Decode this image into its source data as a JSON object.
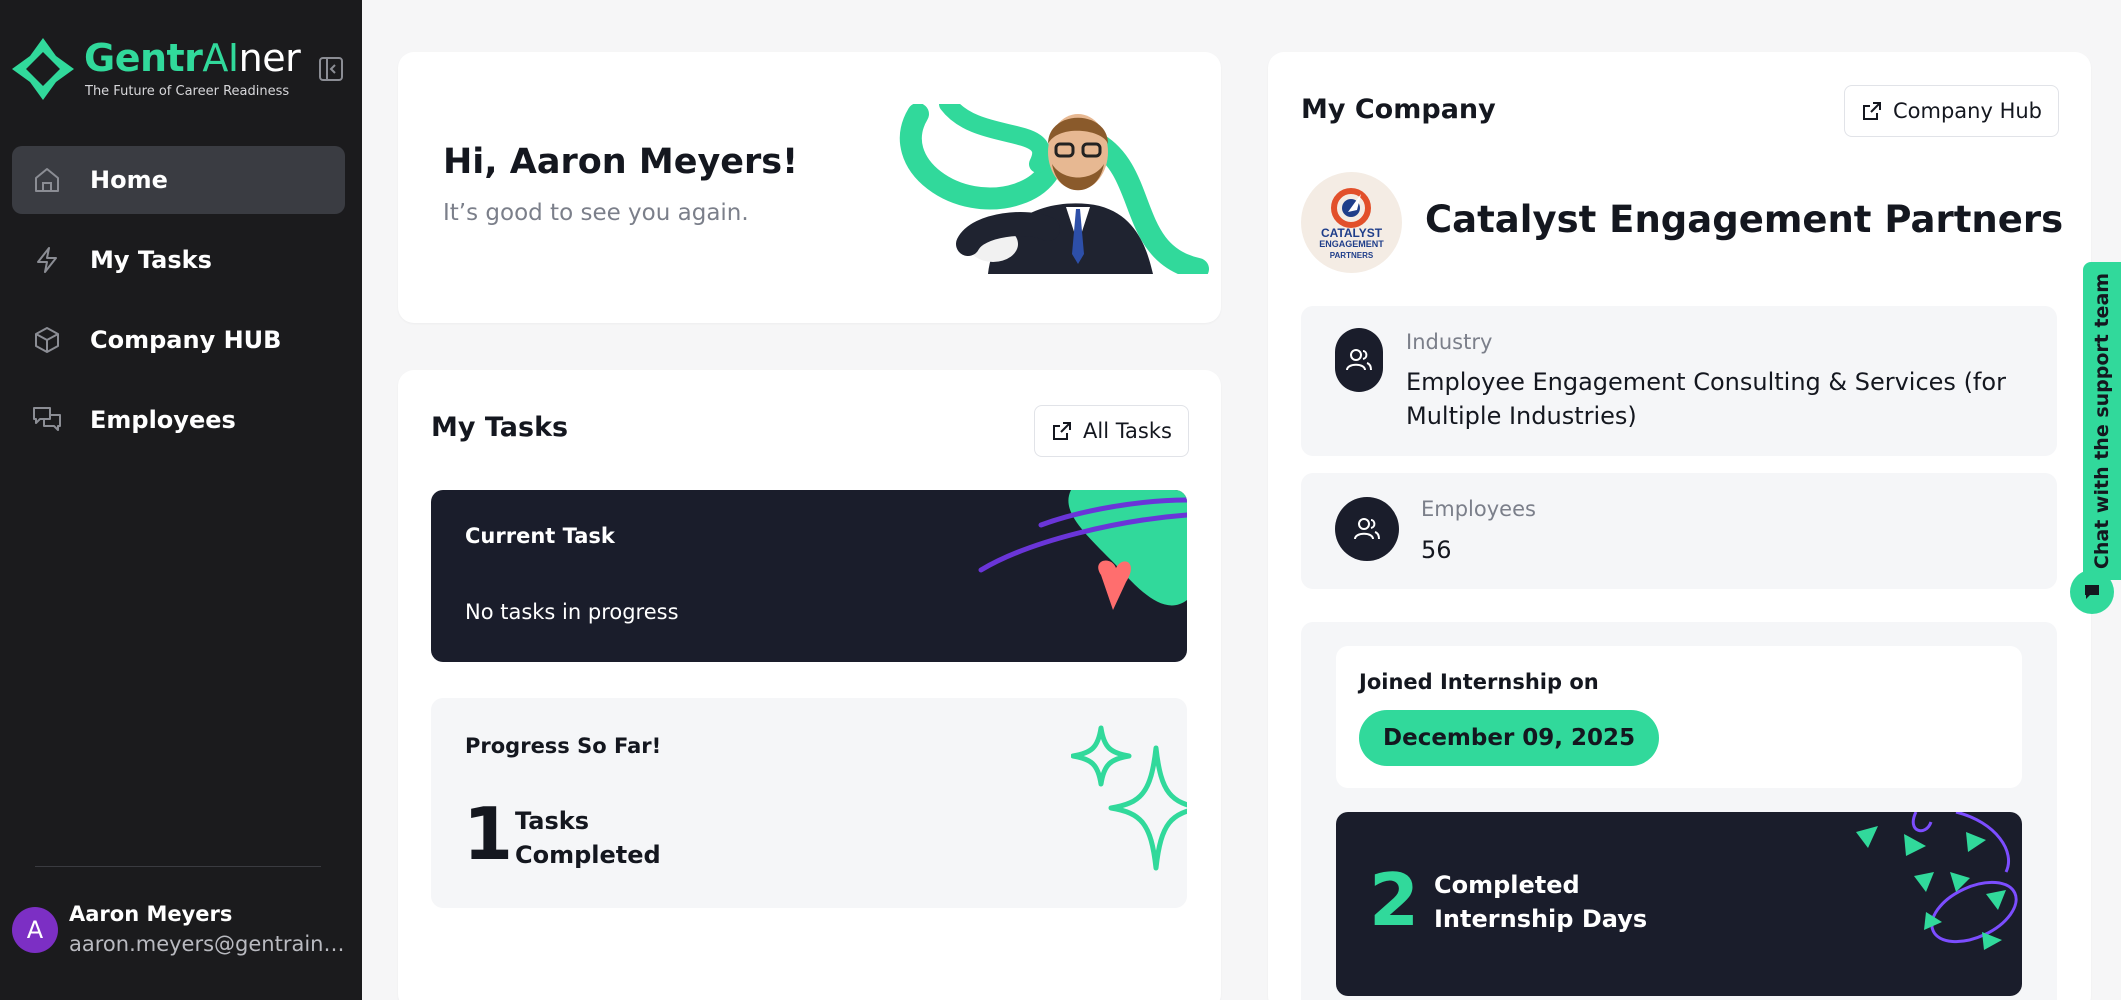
{
  "brand": {
    "name_part1": "Gentr",
    "name_part2": "AI",
    "name_part3": "ner",
    "tagline": "The Future of Career Readiness",
    "accent_color": "#31d99b"
  },
  "sidebar": {
    "items": [
      {
        "label": "Home",
        "icon": "home-icon",
        "active": true
      },
      {
        "label": "My Tasks",
        "icon": "lightning-icon",
        "active": false
      },
      {
        "label": "Company HUB",
        "icon": "cube-icon",
        "active": false
      },
      {
        "label": "Employees",
        "icon": "chat-bubbles-icon",
        "active": false
      }
    ],
    "collapse_icon": "sidebar-collapse-icon"
  },
  "user": {
    "initial": "A",
    "name": "Aaron Meyers",
    "email": "aaron.meyers@gentrainer.com",
    "avatar_color": "#7c2fc4"
  },
  "greeting": {
    "title": "Hi, Aaron Meyers!",
    "subtitle": "It’s good to see you again."
  },
  "tasks": {
    "title": "My Tasks",
    "all_tasks_label": "All Tasks",
    "current_title": "Current Task",
    "current_status": "No tasks in progress",
    "progress_title": "Progress So Far!",
    "completed_count": "1",
    "completed_label": "Tasks Completed"
  },
  "company": {
    "title": "My Company",
    "hub_label": "Company Hub",
    "name": "Catalyst Engagement Partners",
    "logo_line1": "CATALYST",
    "logo_line2": "ENGAGEMENT",
    "logo_line3": "PARTNERS",
    "industry_label": "Industry",
    "industry_value": "Employee Engagement Consulting & Services (for Multiple Industries)",
    "employees_label": "Employees",
    "employees_value": "56",
    "joined_label": "Joined Internship on",
    "joined_date": "December 09, 2025",
    "days_count": "2",
    "days_label": "Completed Internship Days"
  },
  "support": {
    "tab_label": "Chat with the support team"
  }
}
